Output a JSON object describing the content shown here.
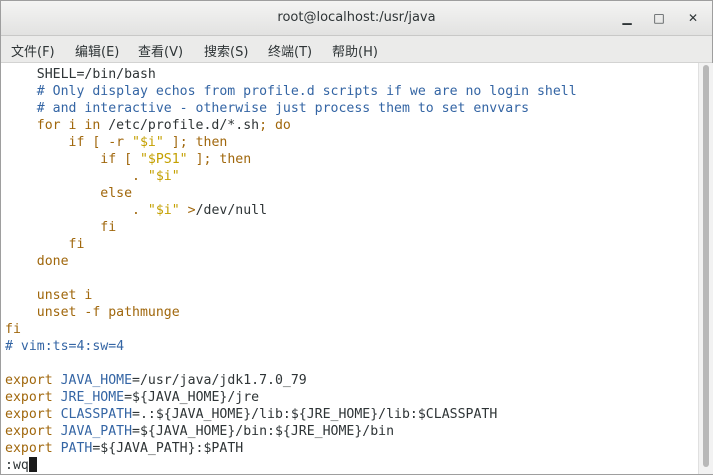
{
  "window": {
    "title": "root@localhost:/usr/java",
    "minimize_glyph": "▁",
    "maximize_glyph": "□",
    "close_glyph": "✕"
  },
  "menu": [
    "文件(F)",
    "编辑(E)",
    "查看(V)",
    "搜索(S)",
    "终端(T)",
    "帮助(H)"
  ],
  "colors": {
    "default": "#2e3436",
    "keyword": "#a0670c",
    "comment": "#3465a4",
    "string": "#c4a000",
    "variable": "#75507b",
    "path": "#2e3436"
  },
  "terminal_lines": [
    [
      {
        "t": "    SHELL=/bin/bash",
        "c": "default"
      }
    ],
    [
      {
        "t": "    # Only display echos from profile.d scripts if we are no login shell",
        "c": "comment"
      }
    ],
    [
      {
        "t": "    # and interactive - otherwise just process them to set envvars",
        "c": "comment"
      }
    ],
    [
      {
        "t": "    for i in ",
        "c": "keyword"
      },
      {
        "t": "/etc/profile.d/*.sh",
        "c": "default"
      },
      {
        "t": "; do",
        "c": "keyword"
      }
    ],
    [
      {
        "t": "        if [ -r ",
        "c": "keyword"
      },
      {
        "t": "\"$i\"",
        "c": "string"
      },
      {
        "t": " ]; then",
        "c": "keyword"
      }
    ],
    [
      {
        "t": "            if [ ",
        "c": "keyword"
      },
      {
        "t": "\"$PS1\"",
        "c": "string"
      },
      {
        "t": " ]; then",
        "c": "keyword"
      }
    ],
    [
      {
        "t": "                . ",
        "c": "keyword"
      },
      {
        "t": "\"$i\"",
        "c": "string"
      }
    ],
    [
      {
        "t": "            else",
        "c": "keyword"
      }
    ],
    [
      {
        "t": "                . ",
        "c": "keyword"
      },
      {
        "t": "\"$i\"",
        "c": "string"
      },
      {
        "t": " >",
        "c": "keyword"
      },
      {
        "t": "/dev/null",
        "c": "default"
      }
    ],
    [
      {
        "t": "            fi",
        "c": "keyword"
      }
    ],
    [
      {
        "t": "        fi",
        "c": "keyword"
      }
    ],
    [
      {
        "t": "    done",
        "c": "keyword"
      }
    ],
    [
      {
        "t": "",
        "c": "default"
      }
    ],
    [
      {
        "t": "    unset i",
        "c": "keyword"
      }
    ],
    [
      {
        "t": "    unset -f pathmunge",
        "c": "keyword"
      }
    ],
    [
      {
        "t": "fi",
        "c": "keyword"
      }
    ],
    [
      {
        "t": "# vim:ts=4:sw=4",
        "c": "comment"
      }
    ],
    [
      {
        "t": "",
        "c": "default"
      }
    ],
    [
      {
        "t": "export ",
        "c": "keyword"
      },
      {
        "t": "JAVA_HOME",
        "c": "comment"
      },
      {
        "t": "=/usr/java/jdk1.7.0_79",
        "c": "default"
      }
    ],
    [
      {
        "t": "export ",
        "c": "keyword"
      },
      {
        "t": "JRE_HOME",
        "c": "comment"
      },
      {
        "t": "=${JAVA_HOME}/jre",
        "c": "default"
      }
    ],
    [
      {
        "t": "export ",
        "c": "keyword"
      },
      {
        "t": "CLASSPATH",
        "c": "comment"
      },
      {
        "t": "=.:${JAVA_HOME}/lib:${JRE_HOME}/lib:$CLASSPATH",
        "c": "default"
      }
    ],
    [
      {
        "t": "export ",
        "c": "keyword"
      },
      {
        "t": "JAVA_PATH",
        "c": "comment"
      },
      {
        "t": "=${JAVA_HOME}/bin:${JRE_HOME}/bin",
        "c": "default"
      }
    ],
    [
      {
        "t": "export ",
        "c": "keyword"
      },
      {
        "t": "PATH",
        "c": "comment"
      },
      {
        "t": "=${JAVA_PATH}:$PATH",
        "c": "default"
      }
    ],
    [
      {
        "t": ":wq",
        "c": "default"
      }
    ]
  ]
}
